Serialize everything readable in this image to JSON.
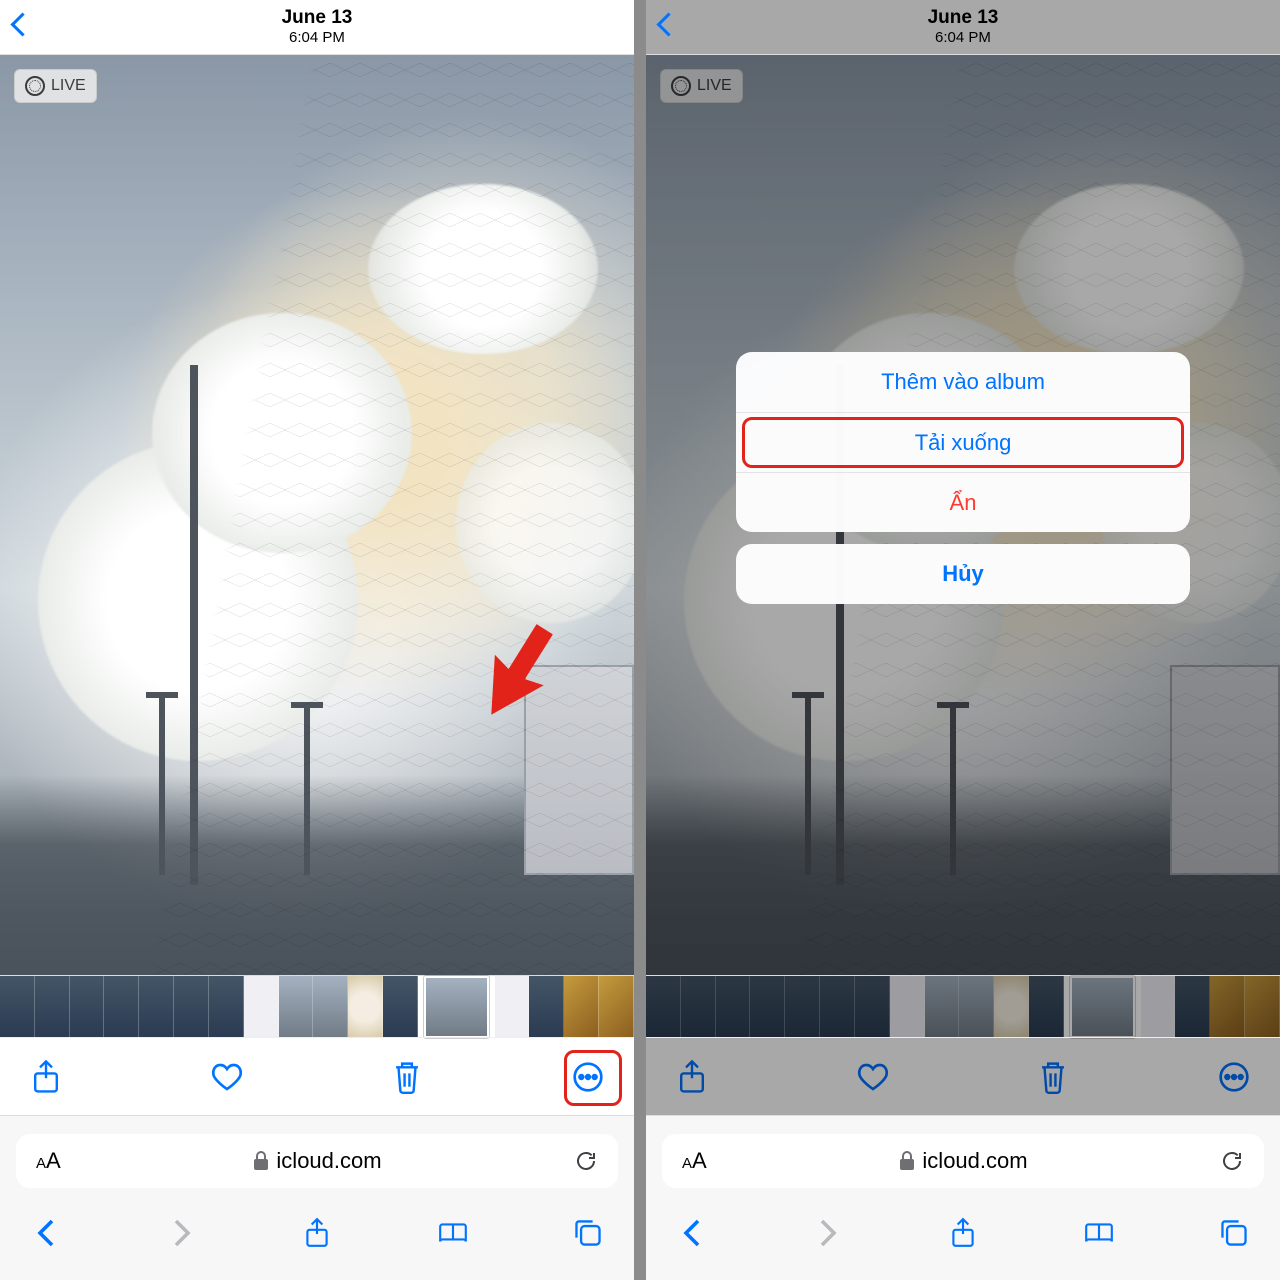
{
  "header": {
    "date": "June 13",
    "time": "6:04 PM"
  },
  "live_badge": "LIVE",
  "safari": {
    "domain": "icloud.com"
  },
  "actionsheet": {
    "add_to_album": "Thêm vào album",
    "download": "Tải xuống",
    "hide": "Ẩn",
    "cancel": "Hủy"
  },
  "icons": {
    "back": "back-chevron",
    "share": "share",
    "heart": "heart",
    "trash": "trash",
    "more": "more-ellipsis",
    "aa": "text-size",
    "lock": "lock",
    "reload": "reload",
    "nav_back": "nav-back",
    "nav_fwd": "nav-forward",
    "nav_share": "nav-share",
    "nav_book": "nav-bookmarks",
    "nav_tabs": "nav-tabs"
  }
}
